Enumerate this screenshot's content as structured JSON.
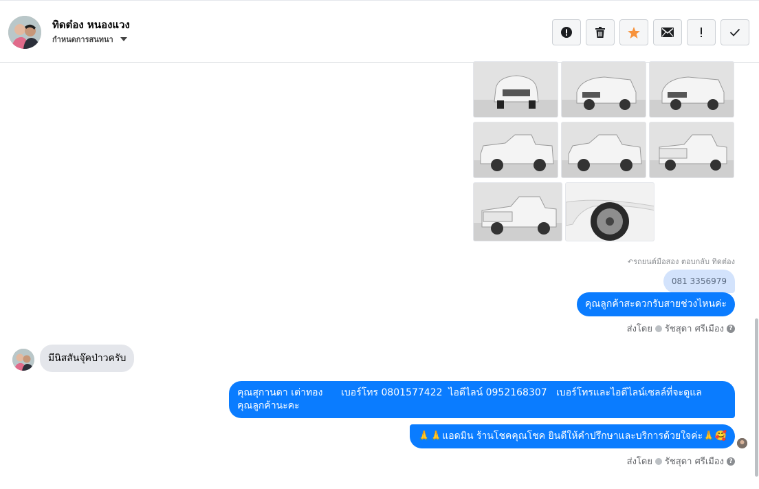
{
  "header": {
    "contact_name": "ทิดต๋อง หนองแวง",
    "assign_label": "กำหนดการสนทนา",
    "toolbar": [
      {
        "icon": "alert-circle-icon"
      },
      {
        "icon": "trash-icon"
      },
      {
        "icon": "star-icon"
      },
      {
        "icon": "mail-icon"
      },
      {
        "icon": "exclamation-icon"
      },
      {
        "icon": "check-icon"
      }
    ]
  },
  "thread": {
    "reply_meta": "รถยนต์มือสอง ตอบกลับ ทิดต๋อง",
    "reply_quote": "081 3356979",
    "msg_out_1": "คุณลูกค้าสะดวกรับสายช่วงไหนค่ะ",
    "sent_by_1": "ส่งโดย",
    "sender_name_1": "รัชสุดา ศรีเมือง",
    "msg_in_1": "มีนิสสันจุ๊คป่าวครับ",
    "msg_out_2_line1": "คุณสุกานดา เต่าทอง      เบอร์โทร 0801577422  ไอดีไลน์ 0952168307   เบอร์โทรและไอดีไลน์เซลล์ที่จะดูแล",
    "msg_out_2_line2": "คุณลูกค้านะคะ",
    "msg_out_3": "🙏🙏แอดมิน ร้านโชคคุณโชค ยินดีให้คำปรึกษาและบริการด้วยใจค่ะ🙏🥰",
    "sent_by_2": "ส่งโดย",
    "sender_name_2": "รัชสุดา ศรีเมือง",
    "help_glyph": "?"
  },
  "colors": {
    "outgoing_bubble": "#0a7cff",
    "incoming_bubble": "#e4e6eb",
    "star": "#f7923b"
  }
}
